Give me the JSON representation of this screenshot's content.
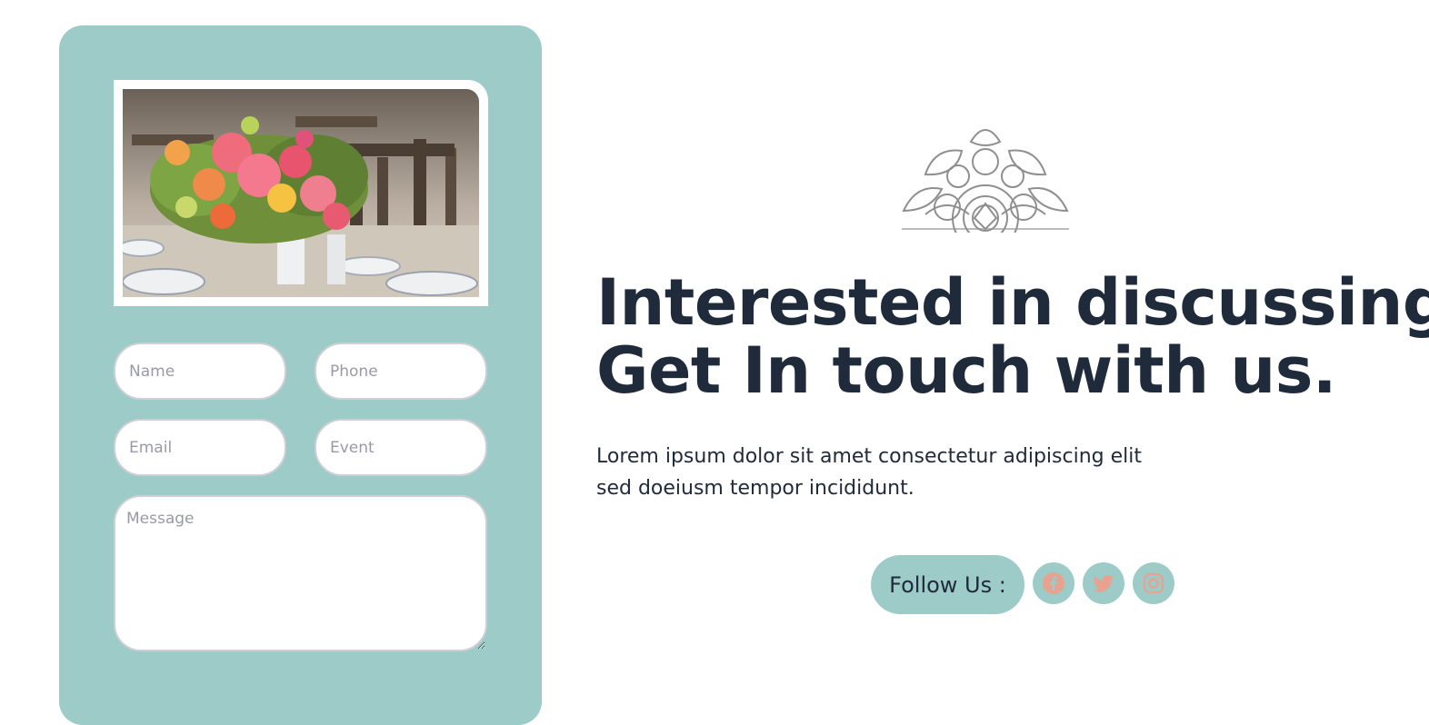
{
  "form": {
    "image_alt": "Wedding table with floral centerpiece",
    "name_placeholder": "Name",
    "phone_placeholder": "Phone",
    "email_placeholder": "Email",
    "event_placeholder": "Event",
    "message_placeholder": "Message"
  },
  "hero": {
    "headline_line1": "Interested in discussing?",
    "headline_line2": "Get In touch with us.",
    "description": "Lorem ipsum dolor sit amet consectetur adipiscing elit sed doeiusm tempor incididunt."
  },
  "social": {
    "follow_label": "Follow Us :",
    "icons": [
      "facebook-icon",
      "twitter-icon",
      "instagram-icon"
    ]
  },
  "colors": {
    "accent_teal": "#9ccbc8",
    "icon_salmon": "#e8a28f",
    "heading": "#1f2a3a"
  }
}
